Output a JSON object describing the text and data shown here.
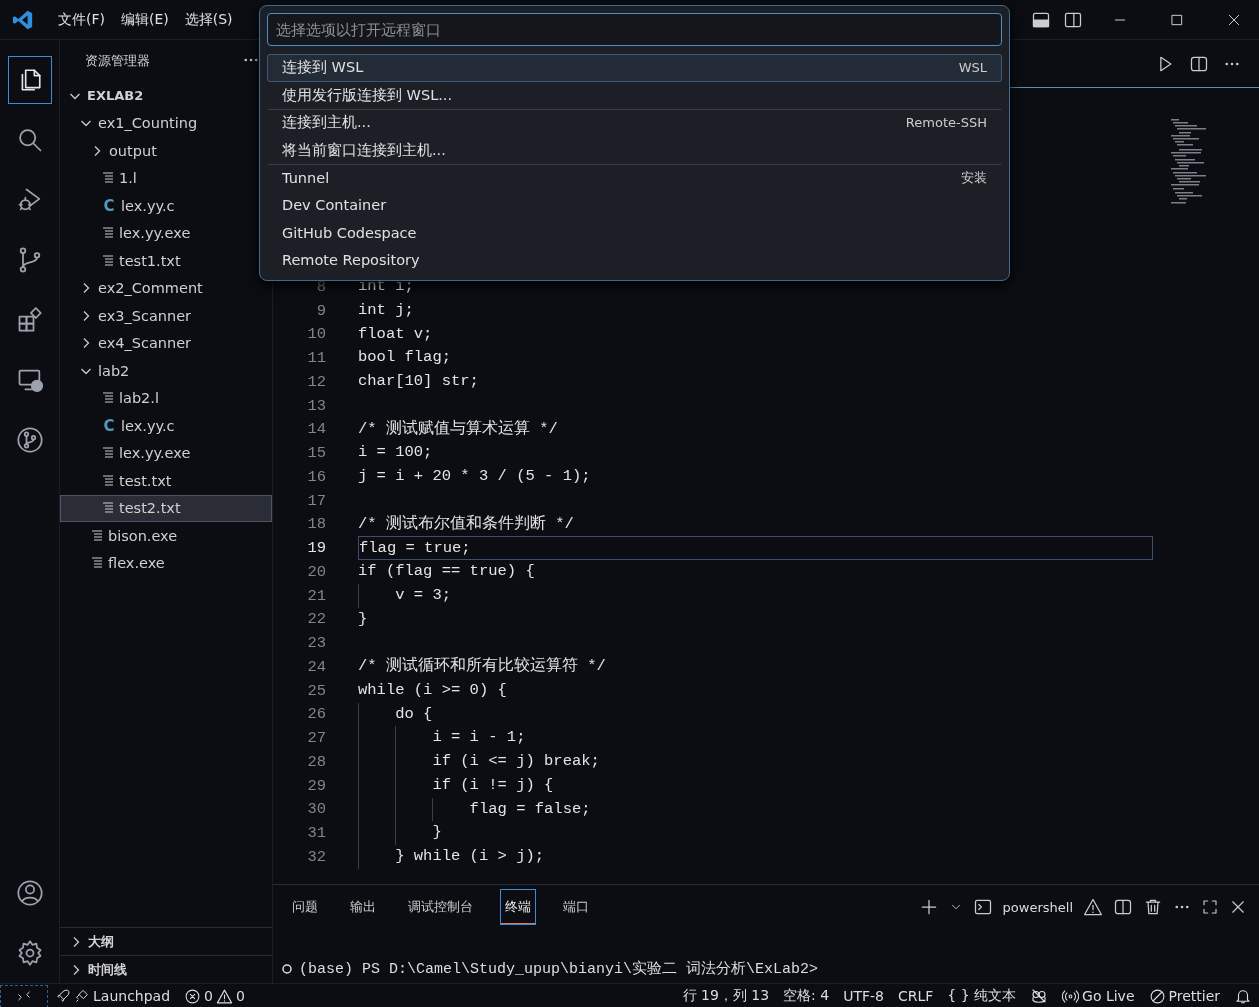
{
  "title_bar": {
    "menus": [
      "文件(F)",
      "编辑(E)",
      "选择(S)"
    ]
  },
  "activity_bar": {
    "items": [
      {
        "kind": "files",
        "selected": true
      },
      {
        "kind": "search",
        "selected": false
      },
      {
        "kind": "debug",
        "selected": false
      },
      {
        "kind": "source-control",
        "selected": false
      },
      {
        "kind": "extensions",
        "selected": false
      },
      {
        "kind": "remote",
        "selected": false
      },
      {
        "kind": "graph",
        "selected": false
      }
    ],
    "bottom": [
      {
        "kind": "account"
      },
      {
        "kind": "settings"
      }
    ]
  },
  "sidebar": {
    "title": "资源管理器",
    "tree": [
      {
        "label": "EXLAB2",
        "kind": "root",
        "expanded": true,
        "selected": false,
        "children": [
          {
            "label": "ex1_Counting",
            "kind": "folder",
            "expanded": true,
            "selected": false,
            "children": [
              {
                "label": "output",
                "kind": "folder",
                "expanded": false,
                "selected": false
              },
              {
                "label": "1.l",
                "kind": "file",
                "selected": false
              },
              {
                "label": "lex.yy.c",
                "kind": "c",
                "icon": "C",
                "selected": false
              },
              {
                "label": "lex.yy.exe",
                "kind": "file",
                "selected": false
              },
              {
                "label": "test1.txt",
                "kind": "file",
                "selected": false
              }
            ]
          },
          {
            "label": "ex2_Comment",
            "kind": "folder",
            "expanded": false,
            "selected": false
          },
          {
            "label": "ex3_Scanner",
            "kind": "folder",
            "expanded": false,
            "selected": false
          },
          {
            "label": "ex4_Scanner",
            "kind": "folder",
            "expanded": false,
            "selected": false
          },
          {
            "label": "lab2",
            "kind": "folder",
            "expanded": true,
            "selected": false,
            "children": [
              {
                "label": "lab2.l",
                "kind": "file",
                "selected": false
              },
              {
                "label": "lex.yy.c",
                "kind": "c",
                "icon": "C",
                "selected": false
              },
              {
                "label": "lex.yy.exe",
                "kind": "file",
                "selected": false
              },
              {
                "label": "test.txt",
                "kind": "file",
                "selected": false
              },
              {
                "label": "test2.txt",
                "kind": "file",
                "selected": true
              }
            ]
          },
          {
            "label": "bison.exe",
            "kind": "file",
            "selected": false
          },
          {
            "label": "flex.exe",
            "kind": "file",
            "selected": false
          }
        ]
      }
    ],
    "sections": [
      {
        "label": "大纲",
        "expanded": false
      },
      {
        "label": "时间线",
        "expanded": false
      }
    ]
  },
  "editor": {
    "lines": [
      {
        "number": "8",
        "text": "int i;",
        "current": false
      },
      {
        "number": "9",
        "text": "int j;",
        "current": false
      },
      {
        "number": "10",
        "text": "float v;",
        "current": false
      },
      {
        "number": "11",
        "text": "bool flag;",
        "current": false
      },
      {
        "number": "12",
        "text": "char[10] str;",
        "current": false
      },
      {
        "number": "13",
        "current": false
      },
      {
        "number": "14",
        "text": "/* 测试赋值与算术运算 */",
        "current": false
      },
      {
        "number": "15",
        "text": "i = 100;",
        "current": false
      },
      {
        "number": "16",
        "text": "j = i + 20 * 3 / (5 - 1);",
        "current": false
      },
      {
        "number": "17",
        "current": false
      },
      {
        "number": "18",
        "text": "/* 测试布尔值和条件判断 */",
        "current": false
      },
      {
        "number": "19",
        "text": "flag = true;",
        "current": true
      },
      {
        "number": "20",
        "text": "if (flag == true) {",
        "current": false
      },
      {
        "number": "21",
        "text": "    v = 3;",
        "current": false
      },
      {
        "number": "22",
        "text": "}",
        "current": false
      },
      {
        "number": "23",
        "current": false
      },
      {
        "number": "24",
        "text": "/* 测试循环和所有比较运算符 */",
        "current": false
      },
      {
        "number": "25",
        "text": "while (i >= 0) {",
        "current": false
      },
      {
        "number": "26",
        "text": "    do {",
        "current": false
      },
      {
        "number": "27",
        "text": "        i = i - 1;",
        "current": false
      },
      {
        "number": "28",
        "text": "        if (i <= j) break;",
        "current": false
      },
      {
        "number": "29",
        "text": "        if (i != j) {",
        "current": false
      },
      {
        "number": "30",
        "text": "            flag = false;",
        "current": false
      },
      {
        "number": "31",
        "text": "        }",
        "current": false
      },
      {
        "number": "32",
        "text": "    } while (i > j);",
        "current": false
      }
    ]
  },
  "quick_pick": {
    "placeholder": "选择选项以打开远程窗口",
    "items": [
      {
        "label": "连接到 WSL",
        "detail": "WSL",
        "selected": true,
        "separator": false
      },
      {
        "label": "使用发行版连接到 WSL...",
        "selected": false,
        "separator": false
      },
      {
        "label": "连接到主机...",
        "detail": "Remote-SSH",
        "selected": false,
        "separator": true
      },
      {
        "label": "将当前窗口连接到主机...",
        "selected": false,
        "separator": false
      },
      {
        "label": "Tunnel",
        "detail": "安装",
        "selected": false,
        "separator": true
      },
      {
        "label": "Dev Container",
        "selected": false,
        "separator": false
      },
      {
        "label": "GitHub Codespace",
        "selected": false,
        "separator": false
      },
      {
        "label": "Remote Repository",
        "selected": false,
        "separator": false
      }
    ]
  },
  "panel": {
    "tabs": [
      {
        "label": "问题",
        "selected": false
      },
      {
        "label": "输出",
        "selected": false
      },
      {
        "label": "调试控制台",
        "selected": false
      },
      {
        "label": "终端",
        "selected": true
      },
      {
        "label": "端口",
        "selected": false
      }
    ],
    "terminal_name": "powershell",
    "terminal_lines": [
      "(base) PS D:\\Camel\\Study_upup\\bianyi\\实验二 词法分析\\ExLab2>"
    ]
  },
  "status_bar": {
    "launchpad": "Launchpad",
    "errors": "0",
    "warnings": "0",
    "items": [
      "行 19，列 13",
      "空格: 4",
      "UTF-8",
      "CRLF"
    ],
    "language_icon": "{ }",
    "language": "纯文本",
    "go_live": "Go Live",
    "prettier": "Prettier"
  }
}
